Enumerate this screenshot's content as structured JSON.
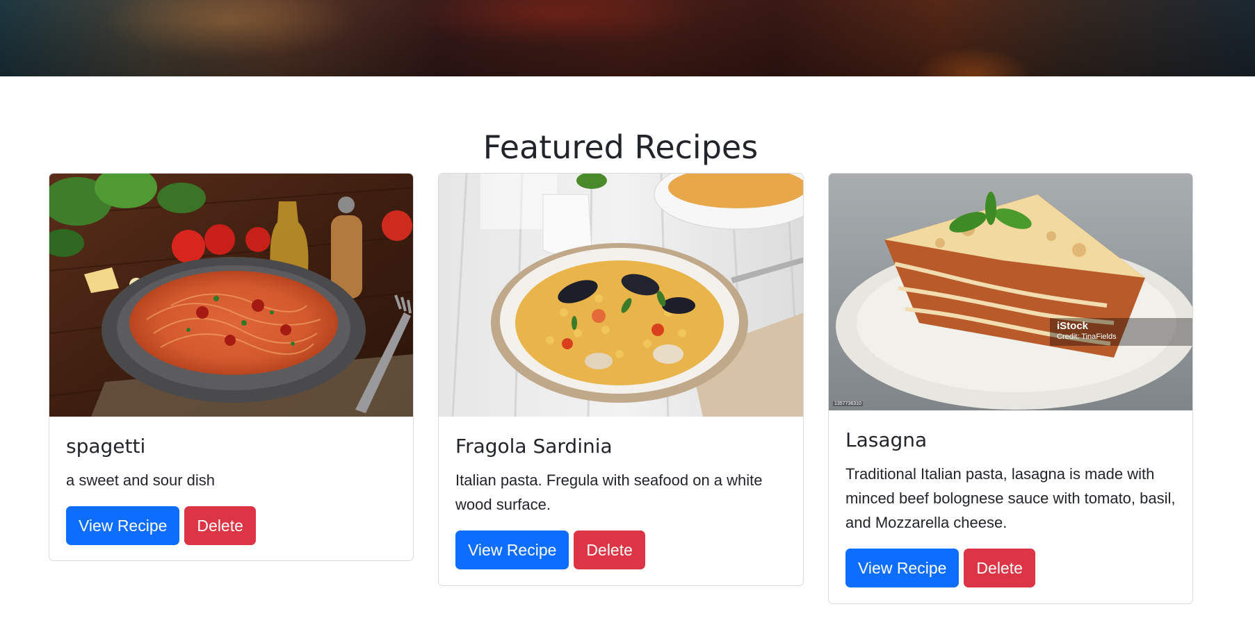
{
  "section": {
    "title": "Featured Recipes"
  },
  "recipes": [
    {
      "title": "spagetti",
      "description": "a sweet and sour dish",
      "view_label": "View Recipe",
      "delete_label": "Delete"
    },
    {
      "title": "Fragola Sardinia",
      "description": "Italian pasta. Fregula with seafood on a white wood surface.",
      "view_label": "View Recipe",
      "delete_label": "Delete"
    },
    {
      "title": "Lasagna",
      "description": "Traditional Italian pasta, lasagna is made with minced beef bolognese sauce with tomato, basil, and Mozzarella cheese.",
      "view_label": "View Recipe",
      "delete_label": "Delete",
      "watermark_brand": "iStock",
      "watermark_credit": "Credit: TinaFields",
      "image_id": "1357736310"
    }
  ]
}
